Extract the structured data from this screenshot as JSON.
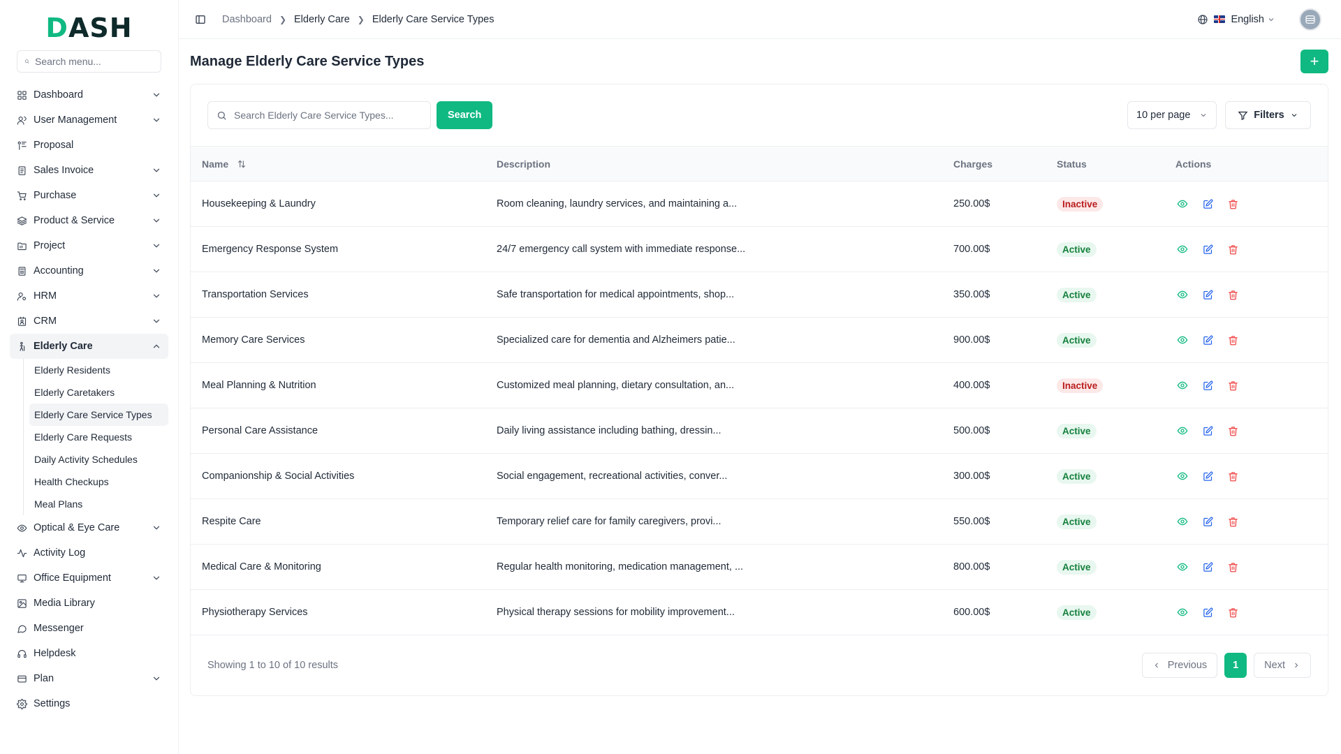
{
  "sidebar": {
    "logo_prefix": "D",
    "logo_rest": "ASH",
    "search_placeholder": "Search menu...",
    "items": [
      {
        "label": "Dashboard",
        "icon": "grid-icon",
        "chevron": true
      },
      {
        "label": "User Management",
        "icon": "users-icon",
        "chevron": true
      },
      {
        "label": "Proposal",
        "icon": "proposal-icon",
        "chevron": false
      },
      {
        "label": "Sales Invoice",
        "icon": "invoice-icon",
        "chevron": true
      },
      {
        "label": "Purchase",
        "icon": "cart-icon",
        "chevron": true
      },
      {
        "label": "Product & Service",
        "icon": "layers-icon",
        "chevron": true
      },
      {
        "label": "Project",
        "icon": "folder-icon",
        "chevron": true
      },
      {
        "label": "Accounting",
        "icon": "calculator-icon",
        "chevron": true
      },
      {
        "label": "HRM",
        "icon": "hrm-icon",
        "chevron": true
      },
      {
        "label": "CRM",
        "icon": "crm-icon",
        "chevron": true
      },
      {
        "label": "Elderly Care",
        "icon": "elderly-icon",
        "chevron": true
      },
      {
        "label": "Optical & Eye Care",
        "icon": "eye-icon",
        "chevron": true
      },
      {
        "label": "Activity Log",
        "icon": "activity-icon",
        "chevron": false
      },
      {
        "label": "Office Equipment",
        "icon": "monitor-icon",
        "chevron": true
      },
      {
        "label": "Media Library",
        "icon": "image-icon",
        "chevron": false
      },
      {
        "label": "Messenger",
        "icon": "message-icon",
        "chevron": false
      },
      {
        "label": "Helpdesk",
        "icon": "headset-icon",
        "chevron": false
      },
      {
        "label": "Plan",
        "icon": "card-icon",
        "chevron": true
      },
      {
        "label": "Settings",
        "icon": "gear-icon",
        "chevron": false
      }
    ],
    "elderly_sub": [
      "Elderly Residents",
      "Elderly Caretakers",
      "Elderly Care Service Types",
      "Elderly Care Requests",
      "Daily Activity Schedules",
      "Health Checkups",
      "Meal Plans"
    ]
  },
  "header": {
    "breadcrumb": [
      "Dashboard",
      "Elderly Care",
      "Elderly Care Service Types"
    ],
    "language": "English"
  },
  "page": {
    "title": "Manage Elderly Care Service Types",
    "add_label": "+",
    "search_placeholder": "Search Elderly Care Service Types...",
    "search_label": "Search",
    "per_page": "10 per page",
    "filters_label": "Filters"
  },
  "table": {
    "columns": [
      "Name",
      "Description",
      "Charges",
      "Status",
      "Actions"
    ],
    "rows": [
      {
        "name": "Housekeeping & Laundry",
        "description": "Room cleaning, laundry services, and maintaining a...",
        "charges": "250.00$",
        "status": "Inactive"
      },
      {
        "name": "Emergency Response System",
        "description": "24/7 emergency call system with immediate response...",
        "charges": "700.00$",
        "status": "Active"
      },
      {
        "name": "Transportation Services",
        "description": "Safe transportation for medical appointments, shop...",
        "charges": "350.00$",
        "status": "Active"
      },
      {
        "name": "Memory Care Services",
        "description": "Specialized care for dementia and Alzheimers patie...",
        "charges": "900.00$",
        "status": "Active"
      },
      {
        "name": "Meal Planning & Nutrition",
        "description": "Customized meal planning, dietary consultation, an...",
        "charges": "400.00$",
        "status": "Inactive"
      },
      {
        "name": "Personal Care Assistance",
        "description": "Daily living assistance including bathing, dressin...",
        "charges": "500.00$",
        "status": "Active"
      },
      {
        "name": "Companionship & Social Activities",
        "description": "Social engagement, recreational activities, conver...",
        "charges": "300.00$",
        "status": "Active"
      },
      {
        "name": "Respite Care",
        "description": "Temporary relief care for family caregivers, provi...",
        "charges": "550.00$",
        "status": "Active"
      },
      {
        "name": "Medical Care & Monitoring",
        "description": "Regular health monitoring, medication management, ...",
        "charges": "800.00$",
        "status": "Active"
      },
      {
        "name": "Physiotherapy Services",
        "description": "Physical therapy sessions for mobility improvement...",
        "charges": "600.00$",
        "status": "Active"
      }
    ]
  },
  "pagination": {
    "showing": "Showing 1 to 10 of 10 results",
    "previous": "Previous",
    "current": "1",
    "next": "Next"
  },
  "colors": {
    "accent": "#10b981",
    "active_bg": "#e8f7ef",
    "active_text": "#15803d",
    "inactive_bg": "#fde8e8",
    "inactive_text": "#b91c1c",
    "view_icon": "#10b981",
    "edit_icon": "#2563eb",
    "delete_icon": "#ef4444"
  }
}
